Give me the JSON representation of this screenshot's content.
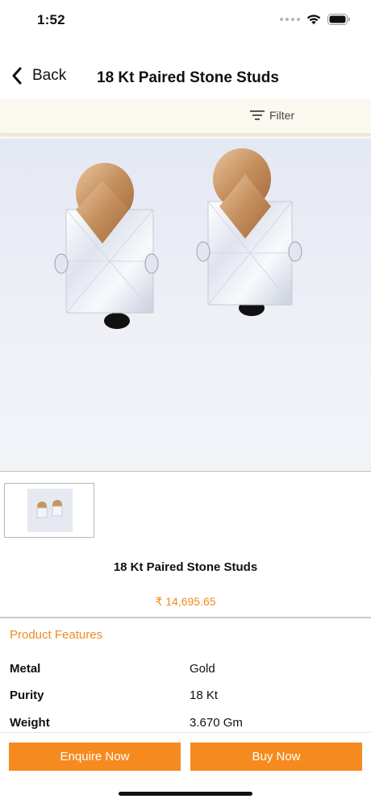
{
  "status_bar": {
    "time": "1:52"
  },
  "nav": {
    "back_label": "Back",
    "title": "18 Kt Paired Stone Studs"
  },
  "filter": {
    "label": "Filter"
  },
  "product": {
    "name": "18 Kt Paired Stone Studs",
    "price": "₹ 14,695.65"
  },
  "features": {
    "title": "Product Features",
    "specs": [
      {
        "key": "Metal",
        "value": "Gold"
      },
      {
        "key": "Purity",
        "value": "18 Kt"
      },
      {
        "key": "Weight",
        "value": "3.670 Gm"
      }
    ]
  },
  "actions": {
    "enquire_label": "Enquire Now",
    "buy_label": "Buy Now"
  },
  "colors": {
    "accent": "#f58b1f",
    "price": "#f08a1e",
    "filter_strip": "#fbf8f0"
  }
}
